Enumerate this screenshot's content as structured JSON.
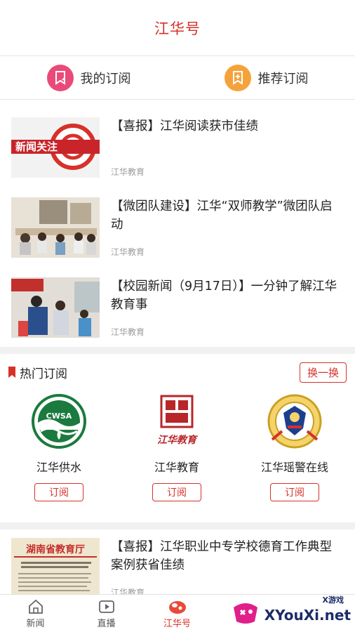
{
  "header": {
    "title": "江华号"
  },
  "subscriptions": {
    "mine_label": "我的订阅",
    "recommended_label": "推荐订阅"
  },
  "news": [
    {
      "title": "【喜报】江华阅读获市佳绩",
      "source": "江华教育",
      "thumb_text": "新闻关注"
    },
    {
      "title": "【微团队建设】江华“双师教学”微团队启动",
      "source": "江华教育"
    },
    {
      "title": "【校园新闻（9月17日）】一分钟了解江华教育事",
      "source": "江华教育"
    }
  ],
  "hot": {
    "title": "热门订阅",
    "swap_label": "换一换",
    "items": [
      {
        "name": "江华供水",
        "button": "订阅",
        "logo_text": "CWSA"
      },
      {
        "name": "江华教育",
        "button": "订阅",
        "logo_text": "江华教育"
      },
      {
        "name": "江华瑶警在线",
        "button": "订阅"
      }
    ]
  },
  "news_more": [
    {
      "title": "【喜报】江华职业中专学校德育工作典型案例获省佳绩",
      "source": "江华教育",
      "thumb_header": "湖南省教育厅"
    }
  ],
  "tabbar": {
    "items": [
      {
        "label": "新闻"
      },
      {
        "label": "直播"
      },
      {
        "label": "江华号"
      }
    ]
  },
  "watermark": {
    "text": "XYouXi.net",
    "small": "X游戏"
  },
  "colors": {
    "accent": "#d7312a",
    "pink": "#ea4a79",
    "orange": "#f5a23a"
  }
}
